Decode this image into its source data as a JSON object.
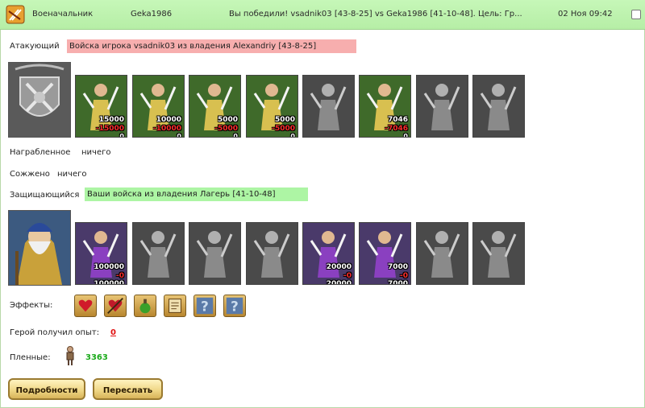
{
  "header": {
    "role": "Военачальник",
    "player": "Geka1986",
    "message": "Вы победили! vsadnik03 [43-8-25] vs Geka1986 [41-10-48]. Цель: Гр...",
    "datetime": "02 Ноя 09:42"
  },
  "attacker": {
    "label": "Атакующий",
    "banner": "Войска игрока vsadnik03 из владения Alexandriy [43-8-25]",
    "banner_color": "#f7aeae",
    "units": [
      {
        "icon": "elf-archer-icon",
        "top": "15000",
        "mid": "-15000",
        "bottom": "0"
      },
      {
        "icon": "elf-swordsman-icon",
        "top": "10000",
        "mid": "-10000",
        "bottom": "0"
      },
      {
        "icon": "elf-paladin-icon",
        "top": "5000",
        "mid": "-5000",
        "bottom": "0"
      },
      {
        "icon": "griffin-icon",
        "top": "5000",
        "mid": "-5000",
        "bottom": "0"
      },
      {
        "icon": "archer-greyed-icon",
        "top": "",
        "mid": "",
        "bottom": ""
      },
      {
        "icon": "elf-mage-icon",
        "top": "7046",
        "mid": "-7046",
        "bottom": "0"
      },
      {
        "icon": "knight-greyed-icon",
        "top": "",
        "mid": "",
        "bottom": ""
      },
      {
        "icon": "druid-greyed-icon",
        "top": "",
        "mid": "",
        "bottom": ""
      }
    ]
  },
  "looted": {
    "label": "Награбленное",
    "value": "ничего"
  },
  "burned": {
    "label": "Сожжено",
    "value": "ничего"
  },
  "defender": {
    "label": "Защищающийся",
    "banner": "Ваши войска из владения Лагерь [41-10-48]",
    "banner_color": "#adf5a4",
    "units": [
      {
        "icon": "ogre-icon",
        "top": "100000",
        "mid": "-0",
        "bottom": "100000"
      },
      {
        "icon": "warrior-greyed-icon",
        "top": "",
        "mid": "",
        "bottom": ""
      },
      {
        "icon": "knights-greyed-icon",
        "top": "",
        "mid": "",
        "bottom": ""
      },
      {
        "icon": "gargoyle-greyed-icon",
        "top": "",
        "mid": "",
        "bottom": ""
      },
      {
        "icon": "dark-archer-icon",
        "top": "20000",
        "mid": "-0",
        "bottom": "20000"
      },
      {
        "icon": "dark-mage-icon",
        "top": "7000",
        "mid": "-0",
        "bottom": "7000"
      },
      {
        "icon": "hooded-warrior-greyed-icon",
        "top": "",
        "mid": "",
        "bottom": ""
      },
      {
        "icon": "spider-rider-greyed-icon",
        "top": "",
        "mid": "",
        "bottom": ""
      }
    ]
  },
  "effects": {
    "label": "Эффекты:",
    "items": [
      "heart-icon",
      "heart-arrow-icon",
      "potion-icon",
      "scroll-icon",
      "question-mark-icon",
      "question-mark-icon"
    ]
  },
  "experience": {
    "label": "Герой получил опыт:",
    "value": "0"
  },
  "prisoners": {
    "label": "Пленные:",
    "value": "3363"
  },
  "buttons": {
    "details": "Подробности",
    "forward": "Переслать"
  }
}
